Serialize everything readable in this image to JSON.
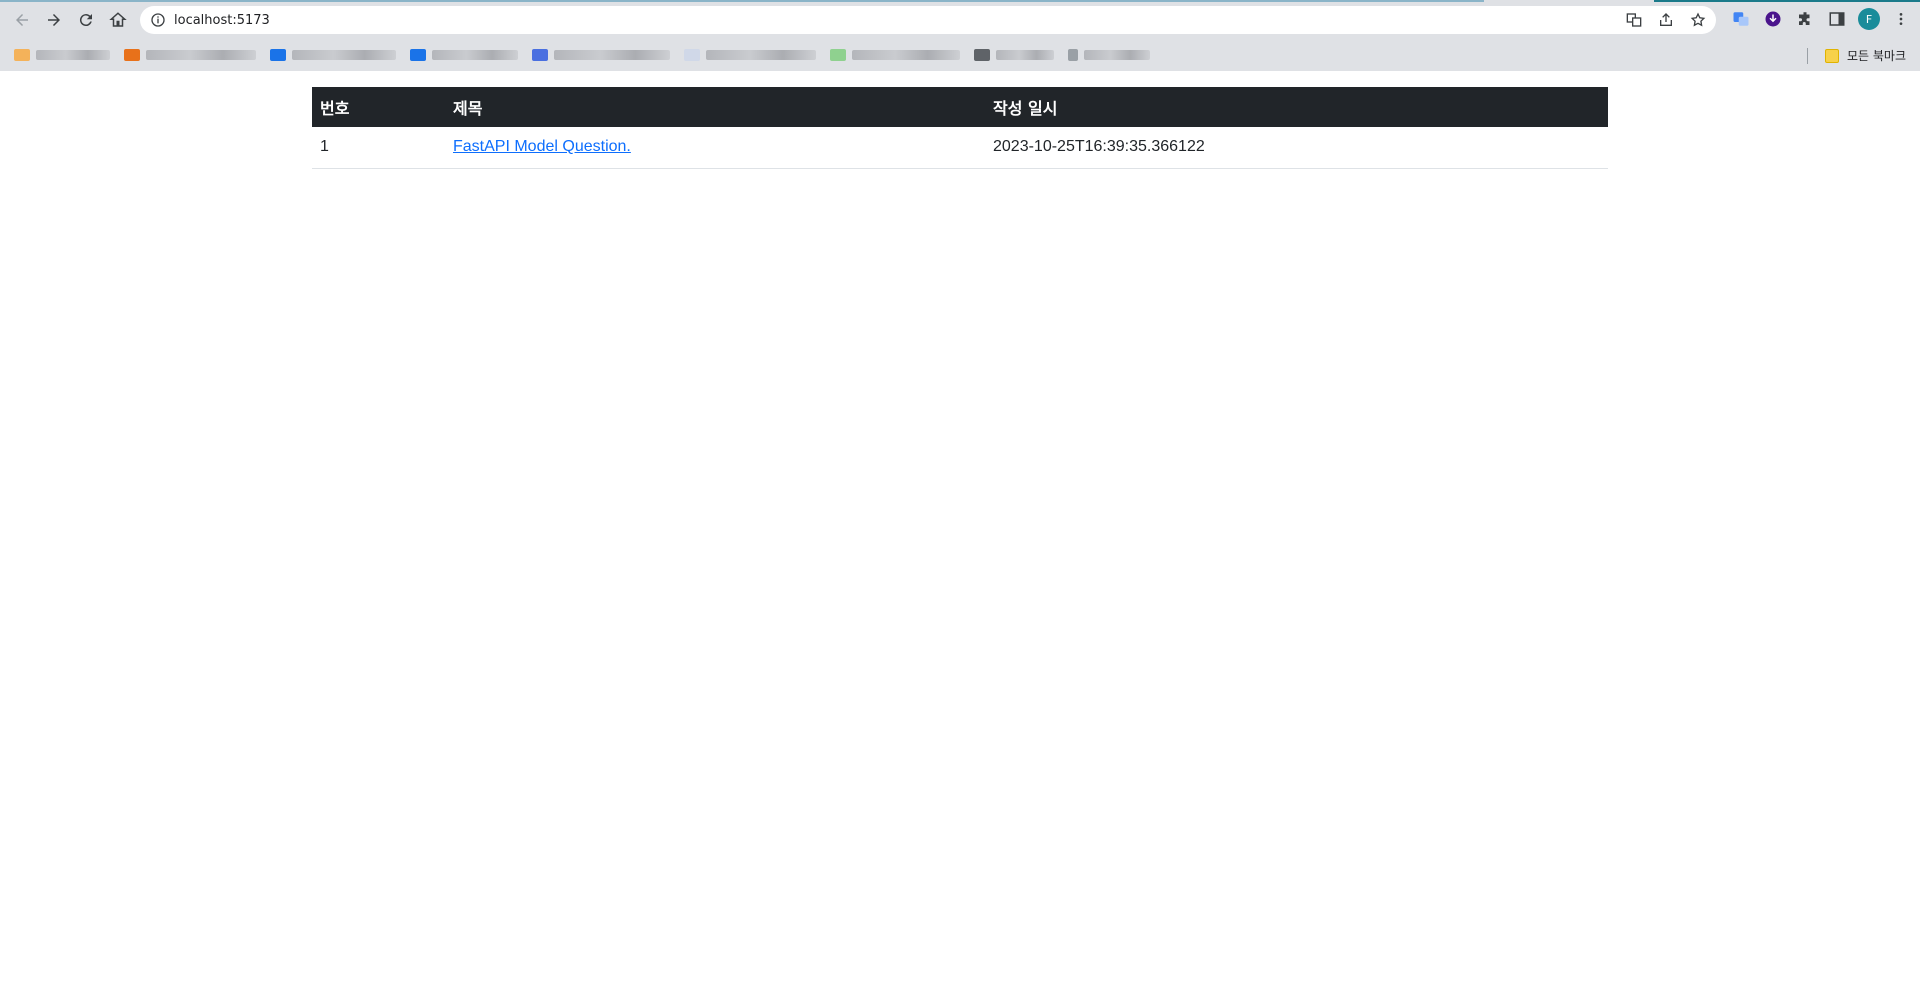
{
  "browser": {
    "url": "localhost:5173",
    "profile_initial": "F",
    "bookmarks_folder_label": "모든 북마크",
    "bookmark_favicon_colors": [
      "#f4b25a",
      "#e8711a",
      "#1a73e8",
      "#1a73e8",
      "#4a6fe0",
      "#d0d8e8",
      "#8fd18f",
      "#5f6368",
      "#9aa0a6"
    ]
  },
  "table": {
    "headers": {
      "number": "번호",
      "title": "제목",
      "created": "작성 일시"
    },
    "rows": [
      {
        "number": "1",
        "title": "FastAPI Model Question.",
        "created": "2023-10-25T16:39:35.366122"
      }
    ]
  },
  "colors": {
    "header_bg": "#212529",
    "link": "#0d6efd"
  }
}
